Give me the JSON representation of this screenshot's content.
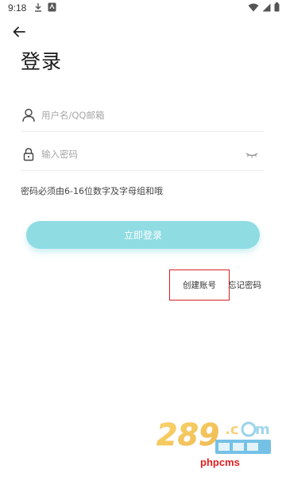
{
  "status_bar": {
    "time": "9:18"
  },
  "header": {
    "back_icon": "arrow-left-icon",
    "title": "登录"
  },
  "form": {
    "username": {
      "icon": "user-icon",
      "placeholder": "用户名/QQ邮箱",
      "value": ""
    },
    "password": {
      "icon": "lock-icon",
      "placeholder": "输入密码",
      "value": "",
      "toggle_icon": "eye-closed-icon"
    },
    "hint": "密码必须由6-16位数字及字母组和哦",
    "login_label": "立即登录",
    "create_account_label": "创建账号",
    "forgot_password_label": "忘记密码"
  },
  "colors": {
    "accent": "#8fdce3",
    "highlight_box": "#d62020"
  },
  "watermark": {
    "site": "phpcms"
  }
}
